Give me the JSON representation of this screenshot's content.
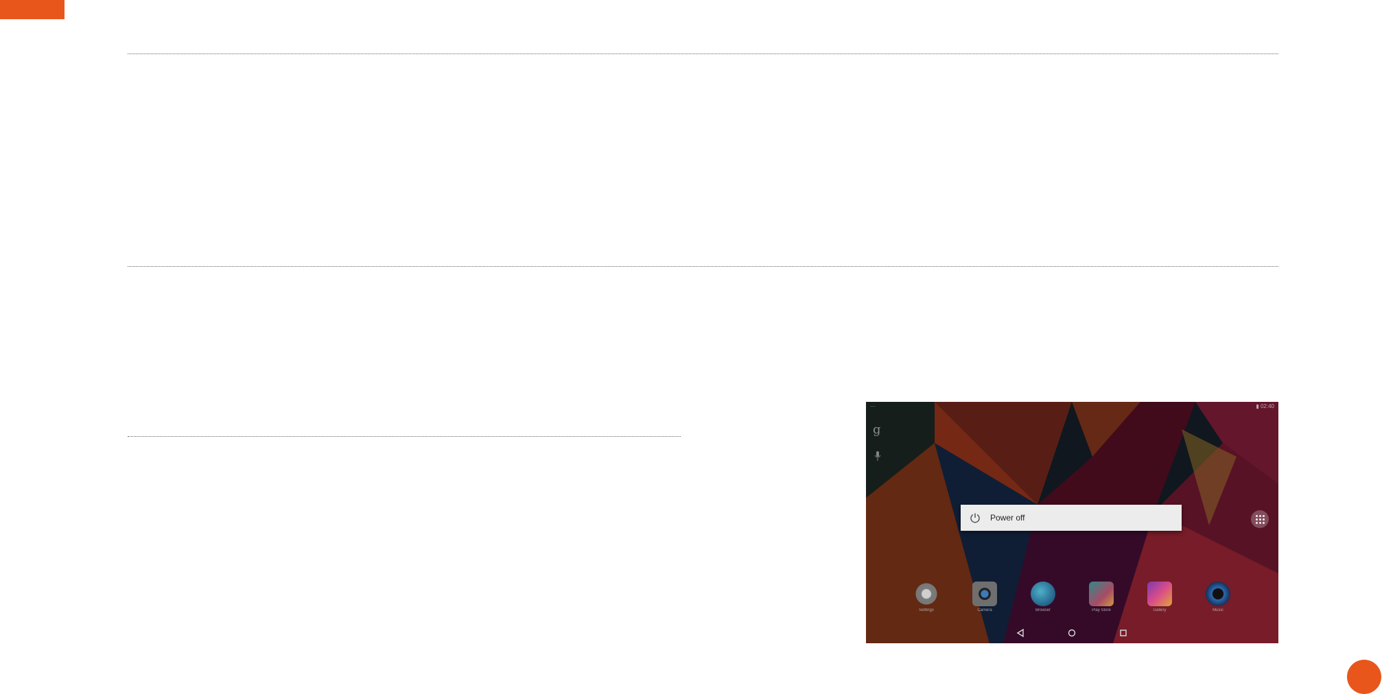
{
  "colors": {
    "accent": "#e8561c",
    "dialog_bg": "#ececec"
  },
  "screenshot": {
    "status_left": "···",
    "status_right": "▮ 02:40",
    "google_icon": "g",
    "mic_icon": "mic-icon",
    "dialog": {
      "icon": "power-icon",
      "label": "Power off"
    },
    "apps": [
      {
        "label": "Settings",
        "icon": "gear-icon"
      },
      {
        "label": "Camera",
        "icon": "camera-icon"
      },
      {
        "label": "Browser",
        "icon": "globe-icon"
      },
      {
        "label": "Play Store",
        "icon": "play-store-icon"
      },
      {
        "label": "Gallery",
        "icon": "gallery-icon"
      },
      {
        "label": "Music",
        "icon": "music-icon"
      }
    ],
    "nav": [
      "back-icon",
      "home-icon",
      "recents-icon"
    ]
  }
}
